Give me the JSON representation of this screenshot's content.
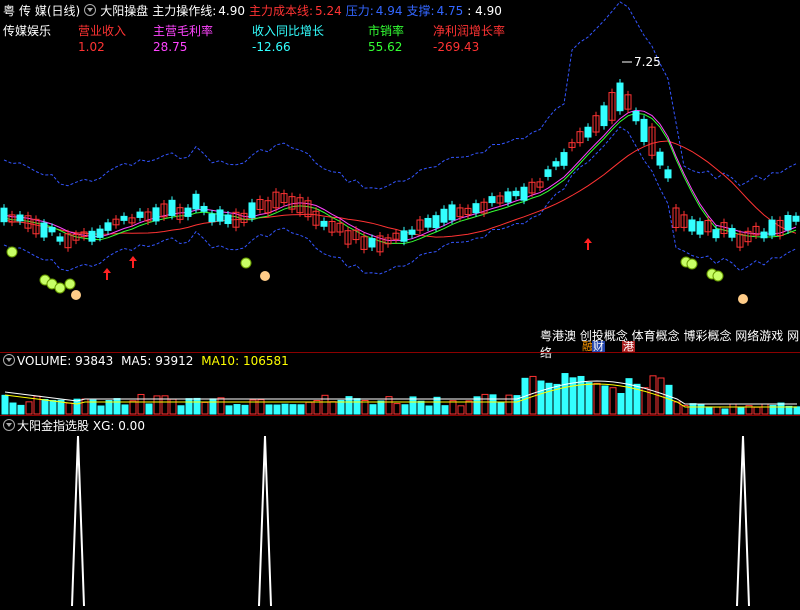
{
  "header": {
    "region": "粤",
    "stock": "传 媒(日线)",
    "indicator": "大阳操盘",
    "op_line_label": "主力操作线:",
    "op_line_value": "4.90",
    "cost_label": "主力成本线:",
    "cost_value": "5.24",
    "pressure_label": "压力:",
    "pressure_value": "4.94",
    "support_label": "支撑:",
    "support_value": "4.75",
    "extra_value": ": 4.90"
  },
  "fund": {
    "sector": "传媒娱乐",
    "columns": [
      {
        "label": "营业收入",
        "value": "1.02",
        "label_color": "#ff3333",
        "value_color": "#ff3333"
      },
      {
        "label": "主营毛利率",
        "value": "28.75",
        "label_color": "#ff44ff",
        "value_color": "#ff44ff"
      },
      {
        "label": "收入同比增长",
        "value": "-12.66",
        "label_color": "#33ffff",
        "value_color": "#33ffff"
      },
      {
        "label": "市销率",
        "value": "55.62",
        "label_color": "#33ff33",
        "value_color": "#33ff33"
      },
      {
        "label": "净利润增长率",
        "value": "-269.43",
        "label_color": "#ff3333",
        "value_color": "#ff3333"
      }
    ]
  },
  "price_annotation": "7.25",
  "concepts": "粤港澳 创投概念 体育概念 博彩概念 网络游戏 网络",
  "tags": {
    "rong": "融",
    "cai": "财",
    "gang": "港"
  },
  "volume": {
    "title": "VOLUME:",
    "value": "93843",
    "ma5_label": "MA5:",
    "ma5_value": "93912",
    "ma10_label": "MA10:",
    "ma10_value": "106581"
  },
  "signal": {
    "title": "大阳金指选股",
    "xg_label": "XG:",
    "xg_value": "0.00"
  },
  "colors": {
    "up": "#ff3333",
    "down": "#33ffff",
    "ma_white": "#ffffff",
    "ma_yellow": "#ffff00",
    "ma_pink": "#ff44ff",
    "ma_green": "#33ff33",
    "ma_red": "#ff3333",
    "band": "#3355ff"
  }
}
